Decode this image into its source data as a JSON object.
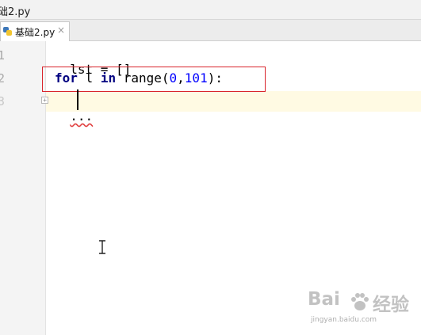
{
  "window": {
    "title": "础2.py"
  },
  "tabs": [
    {
      "label": "基础2.py",
      "icon": "python-file-icon",
      "close": "×"
    }
  ],
  "editor": {
    "line_numbers": [
      "1",
      "2",
      "3"
    ],
    "lines": [
      {
        "text": "lst = []"
      },
      {
        "keyword_for": "for",
        "var": " l ",
        "keyword_in": "in",
        "call": " range(",
        "arg1": "0",
        "comma": ",",
        "arg2": "101",
        "close": "):"
      },
      {
        "text": "..."
      }
    ],
    "fold_marker": "+"
  },
  "watermark": {
    "brand_left": "Bai",
    "brand_right": "经验",
    "url": "jingyan.baidu.com"
  },
  "colors": {
    "keyword": "#000080",
    "number": "#0000ff",
    "highlight_box": "#d9242b",
    "current_line": "#fffae3"
  }
}
